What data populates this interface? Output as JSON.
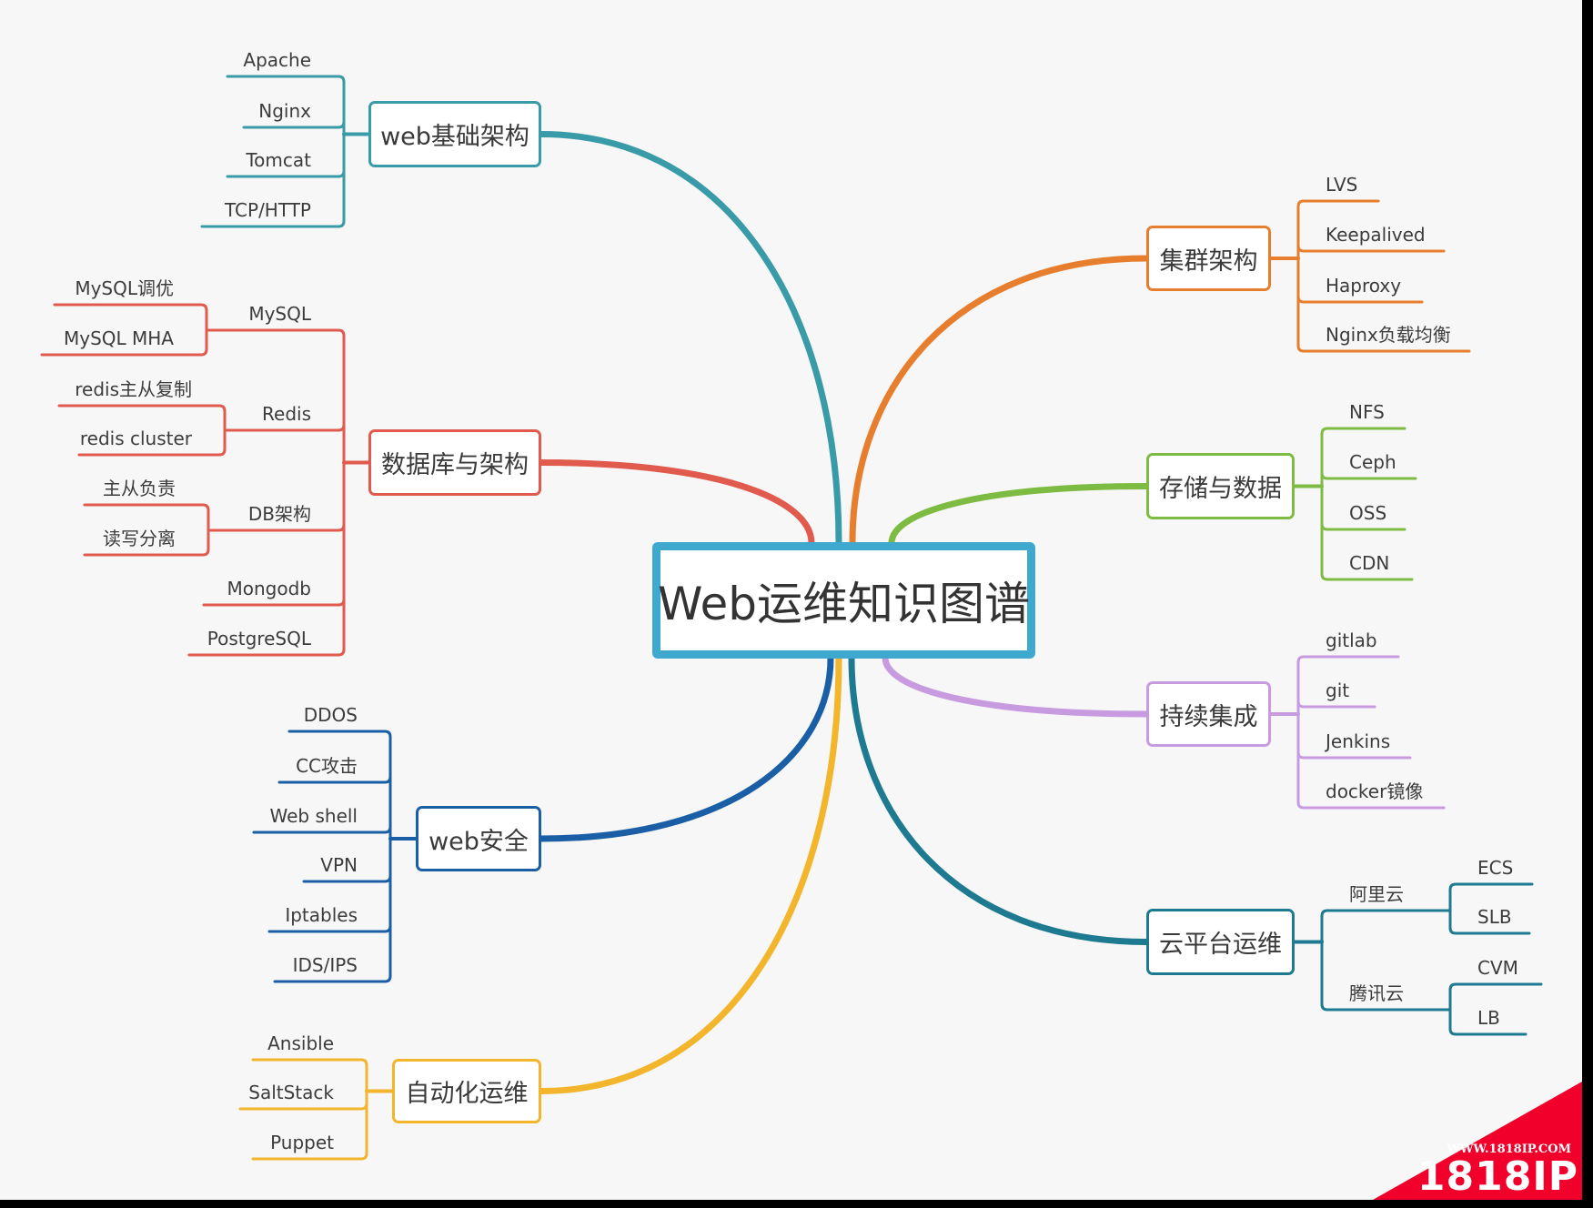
{
  "title": "Web运维知识图谱",
  "colors": {
    "center_border": "#3ea8cf",
    "web_basic": "#3a9ba8",
    "database": "#e05a4e",
    "web_security": "#1a5fa6",
    "automation": "#f2b52c",
    "cluster": "#e67e2d",
    "storage": "#7dbb42",
    "ci": "#c89be0",
    "cloud": "#1d7a90",
    "watermark": "#f0002b"
  },
  "branches": [
    {
      "id": "web_basic",
      "label": "web基础架构",
      "color_key": "web_basic",
      "children": [
        {
          "label": "Apache"
        },
        {
          "label": "Nginx"
        },
        {
          "label": "Tomcat"
        },
        {
          "label": "TCP/HTTP"
        }
      ]
    },
    {
      "id": "database",
      "label": "数据库与架构",
      "color_key": "database",
      "children": [
        {
          "label": "MySQL",
          "children": [
            {
              "label": "MySQL调优"
            },
            {
              "label": "MySQL MHA"
            }
          ]
        },
        {
          "label": "Redis",
          "children": [
            {
              "label": "redis主从复制"
            },
            {
              "label": "redis cluster"
            }
          ]
        },
        {
          "label": "DB架构",
          "children": [
            {
              "label": "主从负责"
            },
            {
              "label": "读写分离"
            }
          ]
        },
        {
          "label": "Mongodb"
        },
        {
          "label": "PostgreSQL"
        }
      ]
    },
    {
      "id": "web_security",
      "label": "web安全",
      "color_key": "web_security",
      "children": [
        {
          "label": "DDOS"
        },
        {
          "label": "CC攻击"
        },
        {
          "label": "Web shell"
        },
        {
          "label": "VPN"
        },
        {
          "label": "Iptables"
        },
        {
          "label": "IDS/IPS"
        }
      ]
    },
    {
      "id": "automation",
      "label": "自动化运维",
      "color_key": "automation",
      "children": [
        {
          "label": "Ansible"
        },
        {
          "label": "SaltStack"
        },
        {
          "label": "Puppet"
        }
      ]
    },
    {
      "id": "cluster",
      "label": "集群架构",
      "color_key": "cluster",
      "children": [
        {
          "label": "LVS"
        },
        {
          "label": "Keepalived"
        },
        {
          "label": "Haproxy"
        },
        {
          "label": "Nginx负载均衡"
        }
      ]
    },
    {
      "id": "storage",
      "label": "存储与数据",
      "color_key": "storage",
      "children": [
        {
          "label": "NFS"
        },
        {
          "label": "Ceph"
        },
        {
          "label": "OSS"
        },
        {
          "label": "CDN"
        }
      ]
    },
    {
      "id": "ci",
      "label": "持续集成",
      "color_key": "ci",
      "children": [
        {
          "label": "gitlab"
        },
        {
          "label": "git"
        },
        {
          "label": "Jenkins"
        },
        {
          "label": "docker镜像"
        }
      ]
    },
    {
      "id": "cloud",
      "label": "云平台运维",
      "color_key": "cloud",
      "children": [
        {
          "label": "阿里云",
          "children": [
            {
              "label": "ECS"
            },
            {
              "label": "SLB"
            }
          ]
        },
        {
          "label": "腾讯云",
          "children": [
            {
              "label": "CVM"
            },
            {
              "label": "LB"
            }
          ]
        }
      ]
    }
  ],
  "watermark": {
    "url": "WWW.1818IP.COM",
    "brand": "1818IP"
  }
}
